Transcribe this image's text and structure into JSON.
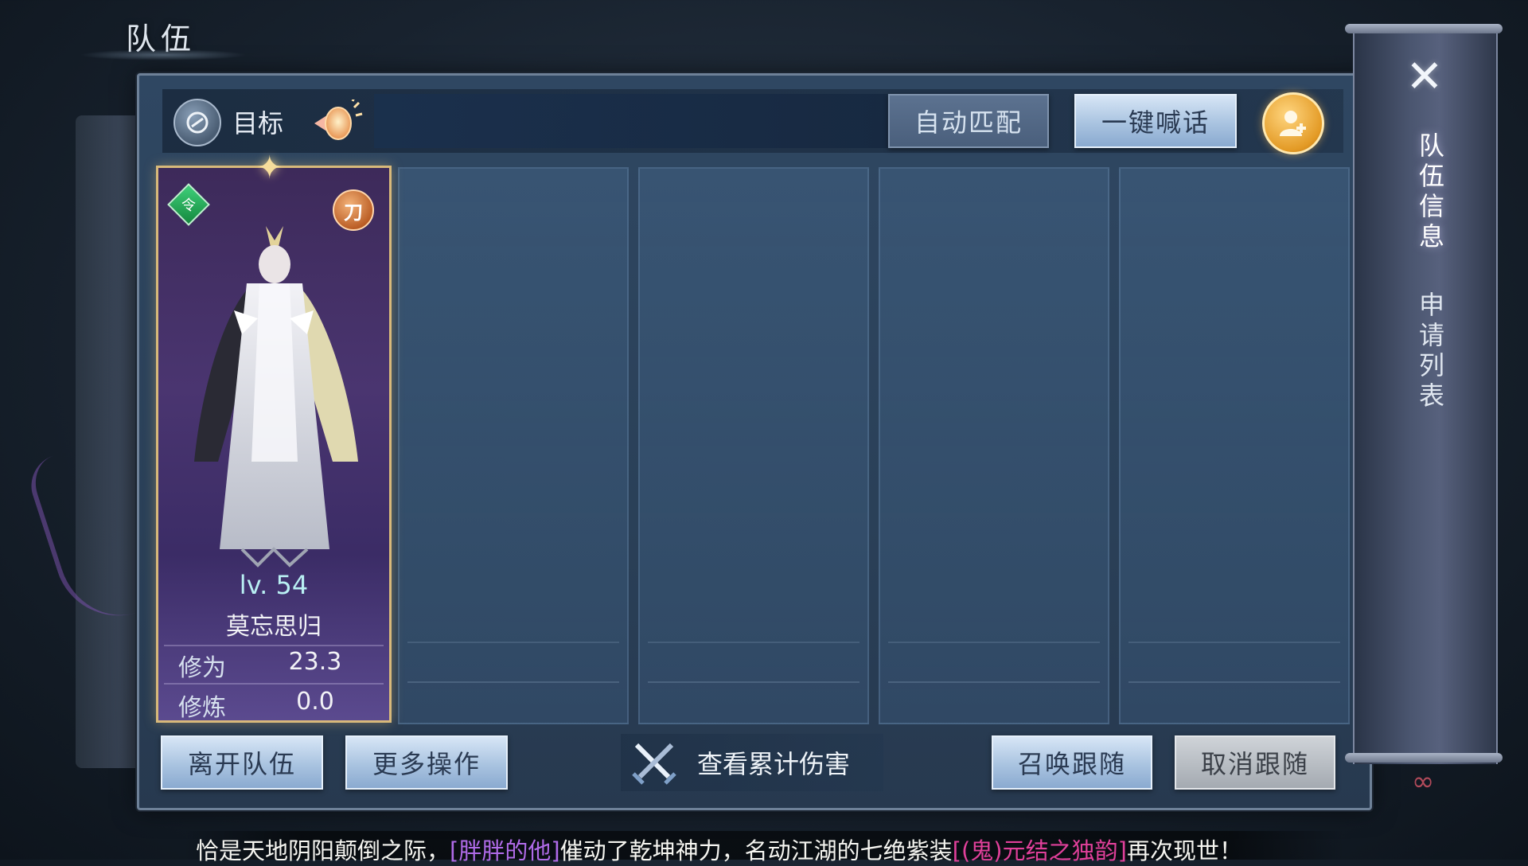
{
  "page_title": "队伍",
  "top_bar": {
    "target_label": "目标",
    "auto_match_label": "自动匹配",
    "shout_label": "一键喊话"
  },
  "member": {
    "level": "lv. 54",
    "name": "莫忘思归",
    "stats": [
      {
        "label": "修为",
        "value": "23.3"
      },
      {
        "label": "修炼",
        "value": "0.0"
      }
    ],
    "leader_badge_glyph": "令",
    "class_glyph": "刀"
  },
  "bottom_bar": {
    "leave_team_label": "离开队伍",
    "more_actions_label": "更多操作",
    "damage_label": "查看累计伤害",
    "summon_follow_label": "召唤跟随",
    "cancel_follow_label": "取消跟随"
  },
  "side_tabs": [
    {
      "label": "队伍信息",
      "active": true
    },
    {
      "label": "申请列表",
      "active": false
    }
  ],
  "announcement": {
    "part1": "恰是天地阴阳颠倒之际，",
    "player": "[胖胖的他]",
    "part2": "催动了乾坤神力，名动江湖的七绝紫装",
    "item": "[(鬼)元结之独韵]",
    "part3": "再次现世！"
  },
  "icons": {
    "target": "target-icon",
    "horn": "horn-icon",
    "add_member": "add-member-icon",
    "close": "close-icon",
    "swords": "crossed-swords-icon",
    "star": "star-icon"
  },
  "colors": {
    "button_light": "#a9c3e0",
    "button_gray": "#a4aab1",
    "card_border": "#d8b97a",
    "level_text": "#b9f0f3",
    "player_name": "#b06be8",
    "item_name": "#e0409a"
  }
}
